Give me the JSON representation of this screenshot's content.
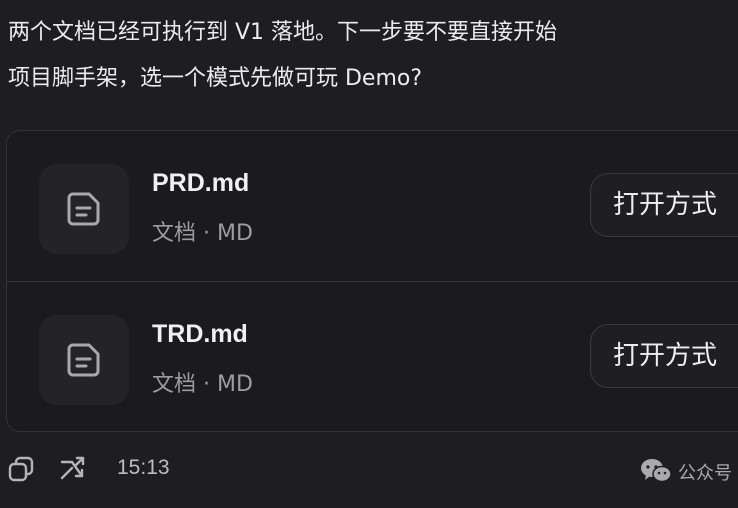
{
  "message": {
    "line1": "两个文档已经可执行到 V1 落地。下一步要不要直接开始",
    "line2": "项目脚手架，选一个模式先做可玩 Demo?"
  },
  "files": [
    {
      "name": "PRD.md",
      "meta": "文档 · MD",
      "icon": "document-icon",
      "open_label": "打开方式"
    },
    {
      "name": "TRD.md",
      "meta": "文档 · MD",
      "icon": "document-icon",
      "open_label": "打开方式"
    }
  ],
  "footer": {
    "copy_icon": "copy-icon",
    "branch_icon": "branch-icon",
    "time": "15:13",
    "watermark_icon": "wechat-icon",
    "watermark_text": "公众号"
  },
  "colors": {
    "background": "#1e1e20",
    "card_border": "#333336",
    "text_primary": "#ececee",
    "text_secondary": "#9c9ca2"
  }
}
